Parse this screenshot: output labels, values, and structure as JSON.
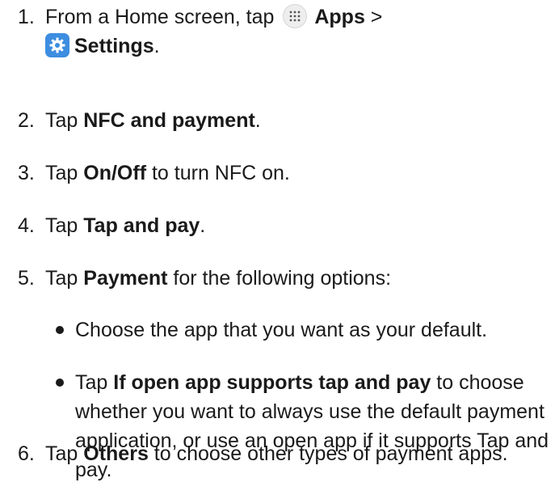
{
  "steps": [
    {
      "num": "1.",
      "pre": "From a Home screen, tap ",
      "apps_label": "Apps",
      "sep": " >",
      "settings_label": "Settings",
      "end": ".",
      "icons": [
        "apps-icon",
        "settings-icon"
      ]
    },
    {
      "num": "2.",
      "pre": "Tap ",
      "bold": "NFC and payment",
      "post": "."
    },
    {
      "num": "3.",
      "pre": "Tap ",
      "bold": "On/Off",
      "post": " to turn NFC on."
    },
    {
      "num": "4.",
      "pre": "Tap ",
      "bold": "Tap and pay",
      "post": "."
    },
    {
      "num": "5.",
      "pre": "Tap ",
      "bold": "Payment",
      "post": " for the following options:"
    },
    {
      "num": "6.",
      "pre": "Tap ",
      "bold": "Others",
      "post": " to choose other types of payment apps."
    }
  ],
  "bullets": [
    {
      "pre": "Choose the app that you want as your default."
    },
    {
      "pre": "Tap ",
      "bold": "If open app supports tap and pay",
      "post": " to choose whether you want to always use the default payment application, or use an open app if it supports Tap and pay."
    }
  ],
  "colors": {
    "text": "#1a1a1a",
    "settings_icon_bg": "#3d8de0",
    "apps_icon_bg": "#eeeeee"
  }
}
